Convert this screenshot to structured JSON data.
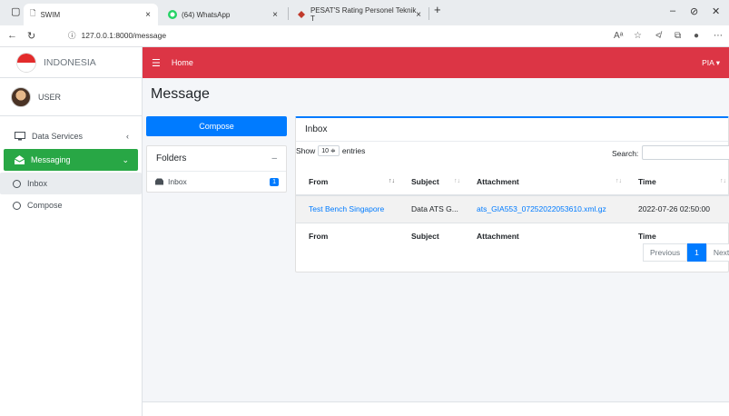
{
  "browser": {
    "tabs": [
      {
        "label": "SWIM"
      },
      {
        "label": "(64) WhatsApp"
      },
      {
        "label": "PESAT'S Rating Personel Teknik T"
      }
    ],
    "close_glyph": "×",
    "new_tab_glyph": "+",
    "url": "127.0.0.1:8000/message"
  },
  "sidebar": {
    "brand": "INDONESIA",
    "user": "USER",
    "items": [
      {
        "label": "Data Services",
        "chevron": "‹"
      },
      {
        "label": "Messaging",
        "chevron": "⌄"
      },
      {
        "label": "Inbox"
      },
      {
        "label": "Compose"
      }
    ]
  },
  "navbar": {
    "home": "Home",
    "user_menu": "PIA ▾"
  },
  "content": {
    "title": "Message",
    "compose_button": "Compose",
    "folders": {
      "header": "Folders",
      "collapse": "–",
      "items": [
        {
          "label": "Inbox",
          "count": "1"
        }
      ]
    },
    "inbox": {
      "header": "Inbox",
      "show_label": "Show",
      "entries_value": "10 ≑",
      "entries_label": "entries",
      "search_label": "Search:",
      "columns": [
        "From",
        "Subject",
        "Attachment",
        "Time"
      ],
      "rows": [
        {
          "from": "Test Bench Singapore",
          "subject": "Data ATS G...",
          "attachment": "ats_GIA553_07252022053610.xml.gz",
          "time": "2022-07-26 02:50:00"
        }
      ],
      "pager": {
        "previous": "Previous",
        "current": "1",
        "next": "Next"
      }
    }
  },
  "colors": {
    "navbar": "#dc3545",
    "messaging_active": "#28a745",
    "primary": "#007bff"
  }
}
